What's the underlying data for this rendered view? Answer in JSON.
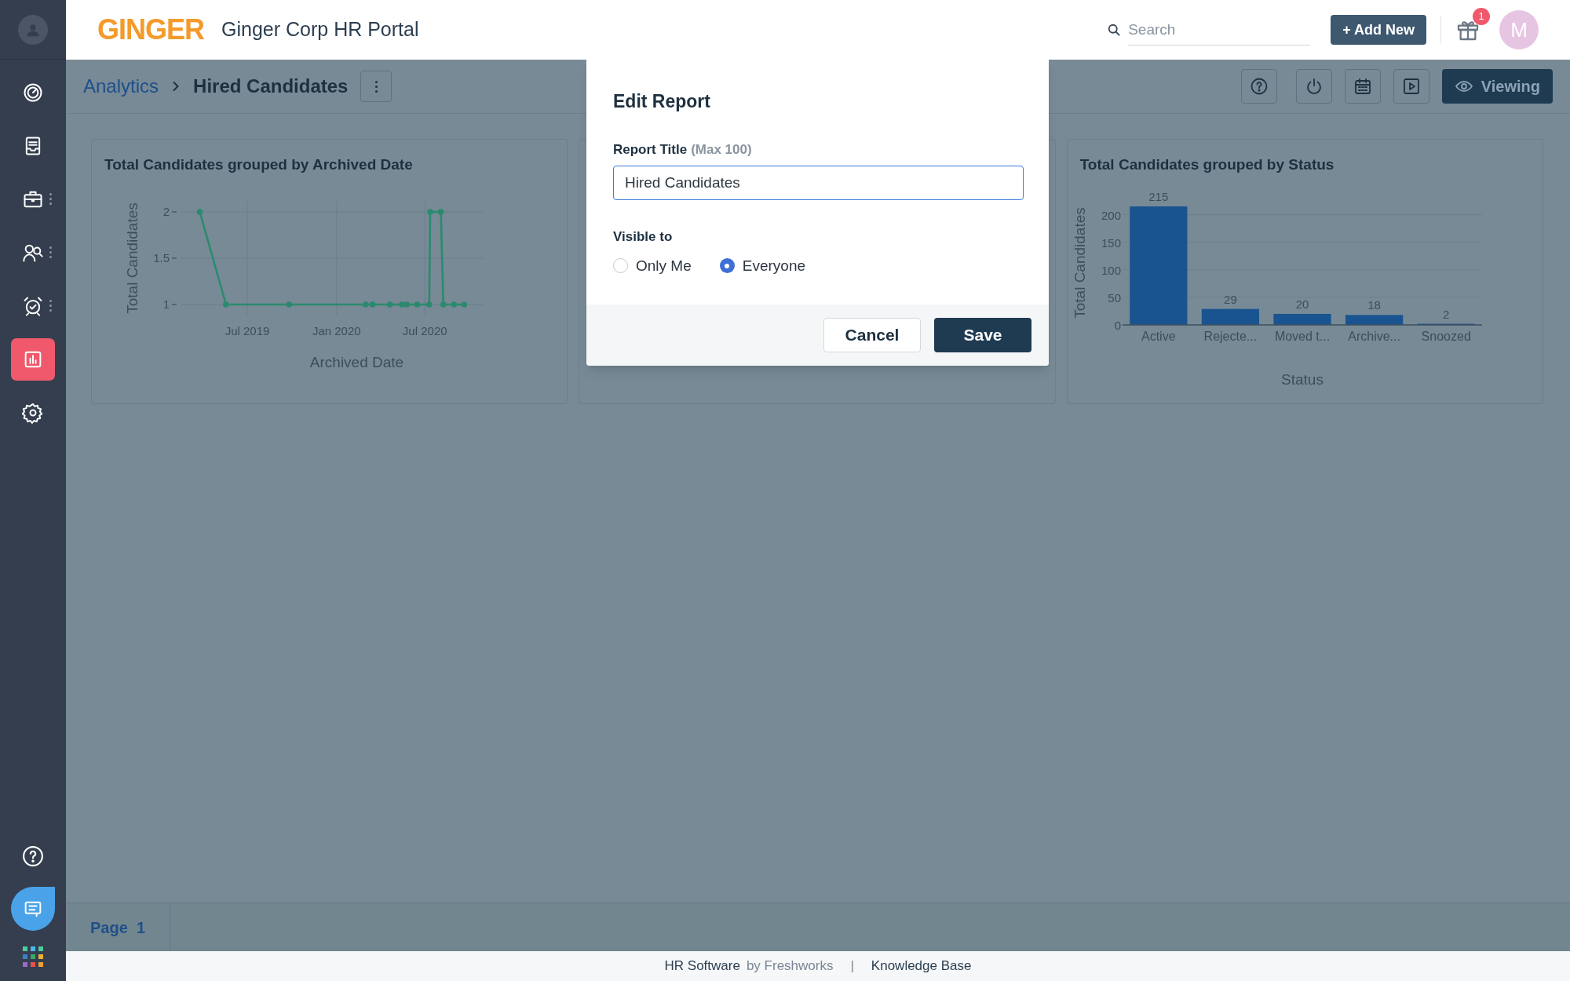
{
  "sidebar": {
    "items": [
      {
        "kind": "dashboard",
        "selected": false,
        "more_menu": false
      },
      {
        "kind": "inbox",
        "selected": false,
        "more_menu": false
      },
      {
        "kind": "briefcase",
        "selected": false,
        "more_menu": true
      },
      {
        "kind": "people",
        "selected": false,
        "more_menu": true
      },
      {
        "kind": "alarm",
        "selected": false,
        "more_menu": true
      },
      {
        "kind": "reports",
        "selected": true,
        "more_menu": false
      },
      {
        "kind": "settings",
        "selected": false,
        "more_menu": false
      }
    ],
    "bottom": [
      {
        "kind": "help"
      },
      {
        "kind": "chat"
      },
      {
        "kind": "apps"
      }
    ]
  },
  "header": {
    "logo": "GINGER",
    "title": "Ginger Corp HR Portal",
    "search": {
      "placeholder": "Search"
    },
    "add_button": "+ Add New",
    "notification_count": "1",
    "avatar": "M"
  },
  "breadcrumb": {
    "items": [
      "Analytics",
      "Hired Candidates"
    ]
  },
  "toolbar": {
    "icons": [
      {
        "kind": "help"
      },
      {
        "kind": "refresh"
      },
      {
        "kind": "calendar"
      },
      {
        "kind": "play"
      }
    ],
    "view_button": "Viewing"
  },
  "cards": [
    {
      "chart_data": {
        "type": "line",
        "title": "Total Candidates grouped by Archived Date",
        "xlabel": "Archived Date",
        "ylabel": "Total Candidates",
        "xlim": [
          "2019-02-15",
          "2020-10-30"
        ],
        "ylim": [
          0.89,
          2.11
        ],
        "xticks": [
          {
            "value": "2019-07-01",
            "label": "Jul 2019"
          },
          {
            "value": "2020-01-01",
            "label": "Jan 2020"
          },
          {
            "value": "2020-07-01",
            "label": "Jul 2020"
          }
        ],
        "yticks": [
          1,
          1.5,
          2
        ],
        "grid": true,
        "x": [
          "2019-03-25",
          "2019-05-18",
          "2019-09-25",
          "2020-03-01",
          "2020-03-15",
          "2020-04-20",
          "2020-05-15",
          "2020-05-25",
          "2020-06-15",
          "2020-07-10",
          "2020-07-12",
          "2020-08-03",
          "2020-08-08",
          "2020-08-30",
          "2020-09-20"
        ],
        "series": [
          {
            "color": "#2b8a6e",
            "marker": true,
            "values": [
              2,
              1,
              1,
              1,
              1,
              1,
              1,
              1,
              1,
              1,
              2,
              2,
              1,
              1,
              1
            ]
          }
        ]
      }
    },
    {
      "kind": "covered"
    },
    {
      "chart_data": {
        "type": "bar",
        "title": "Total Candidates grouped by Status",
        "xlabel": "Status",
        "ylabel": "Total Candidates",
        "categories": [
          "Active",
          "Rejecte...",
          "Moved t...",
          "Archive...",
          "Snoozed"
        ],
        "ylim": [
          0,
          215
        ],
        "yticks": [
          0,
          50,
          100,
          150,
          200
        ],
        "data_labels": true,
        "grid": true,
        "series": [
          {
            "color": "#1a5490",
            "values": [
              215,
              29,
              20,
              18,
              2
            ]
          }
        ]
      }
    }
  ],
  "modal": {
    "title": "Edit Report",
    "field_label": "Report Title",
    "field_hint": "(Max 100)",
    "field_value": "Hired Candidates",
    "visibility_label": "Visible to",
    "options": [
      {
        "label": "Only Me",
        "selected": false
      },
      {
        "label": "Everyone",
        "selected": true
      }
    ],
    "buttons": [
      {
        "kind": "secondary",
        "label": "Cancel"
      },
      {
        "kind": "primary",
        "label": "Save"
      }
    ]
  },
  "footer": {
    "page_tab": "Page  1",
    "links": [
      {
        "kind": "strong",
        "text": "HR Software"
      },
      {
        "kind": "muted",
        "text": "by Freshworks"
      },
      {
        "kind": "muted",
        "text": "|"
      },
      {
        "kind": "strong",
        "text": "Knowledge Base"
      }
    ]
  }
}
